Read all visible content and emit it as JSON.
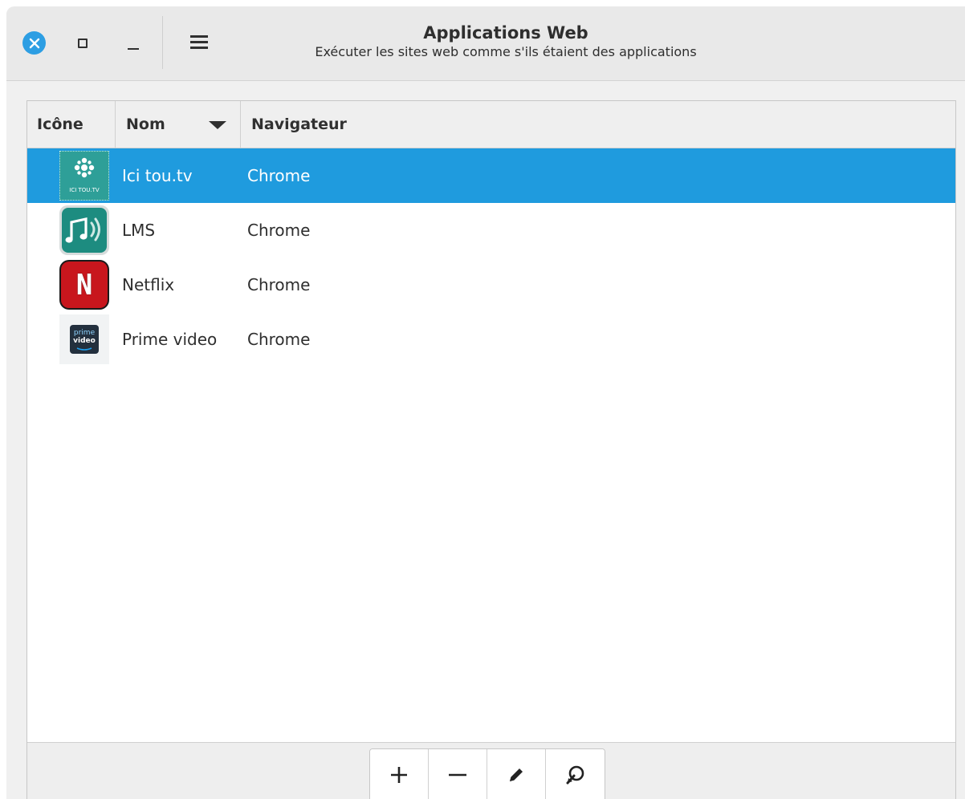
{
  "window": {
    "title": "Applications Web",
    "subtitle": "Exécuter les sites web comme s'ils étaient des applications"
  },
  "table": {
    "columns": [
      {
        "label": "Icône"
      },
      {
        "label": "Nom",
        "sort": "descending"
      },
      {
        "label": "Navigateur"
      }
    ],
    "rows": [
      {
        "icon": "ici-tou-tv-icon",
        "icon_text": "ICI TOU.TV",
        "name": "Ici tou.tv",
        "browser": "Chrome",
        "selected": true
      },
      {
        "icon": "lms-music-icon",
        "name": "LMS",
        "browser": "Chrome",
        "selected": false
      },
      {
        "icon": "netflix-icon",
        "icon_text": "N",
        "name": "Netflix",
        "browser": "Chrome",
        "selected": false
      },
      {
        "icon": "prime-video-icon",
        "icon_text_top": "prime",
        "icon_text_bottom": "video",
        "name": "Prime video",
        "browser": "Chrome",
        "selected": false
      }
    ]
  },
  "toolbar": {
    "buttons": [
      "add-icon",
      "remove-icon",
      "edit-icon",
      "launch-icon"
    ]
  },
  "colors": {
    "selection": "#1f9bde",
    "close_button": "#2d9ee3"
  }
}
